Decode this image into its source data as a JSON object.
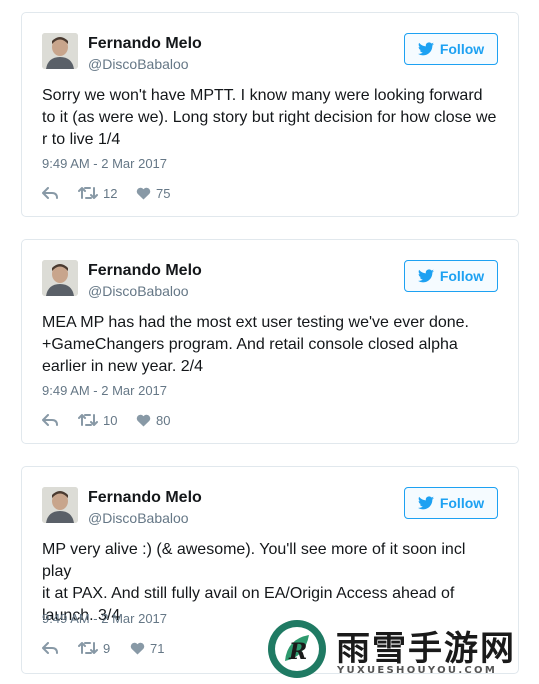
{
  "colors": {
    "accent": "#1da1f2",
    "muted": "#657786",
    "text": "#14171a",
    "border": "#e1e8ed"
  },
  "tweets": [
    {
      "name": "Fernando Melo",
      "handle": "@DiscoBabaloo",
      "follow_label": "Follow",
      "lines": [
        "Sorry we won't have MPTT. I know many were looking forward",
        "to it (as were we). Long story but right decision for how close we",
        "r to live 1/4"
      ],
      "timestamp": "9:49 AM - 2 Mar 2017",
      "retweets": "12",
      "likes": "75"
    },
    {
      "name": "Fernando Melo",
      "handle": "@DiscoBabaloo",
      "follow_label": "Follow",
      "lines": [
        "MEA MP has had the most ext user testing we've ever done.",
        "+GameChangers program. And retail console closed alpha",
        "earlier in new year. 2/4"
      ],
      "timestamp": "9:49 AM - 2 Mar 2017",
      "retweets": "10",
      "likes": "80"
    },
    {
      "name": "Fernando Melo",
      "handle": "@DiscoBabaloo",
      "follow_label": "Follow",
      "lines": [
        "MP very alive :) (& awesome). You'll see more of it soon incl play",
        "it at PAX. And still fully avail on EA/Origin Access ahead of",
        "launch. 3/4"
      ],
      "timestamp": "9:49 AM - 2 Mar 2017",
      "retweets": "9",
      "likes": "71"
    }
  ],
  "watermark": {
    "name_cn": "雨雪手游网",
    "name_en": "YUXUESHOUYOU.COM",
    "logo_letter": "R",
    "logo_icon": "leaf-logo-icon"
  }
}
